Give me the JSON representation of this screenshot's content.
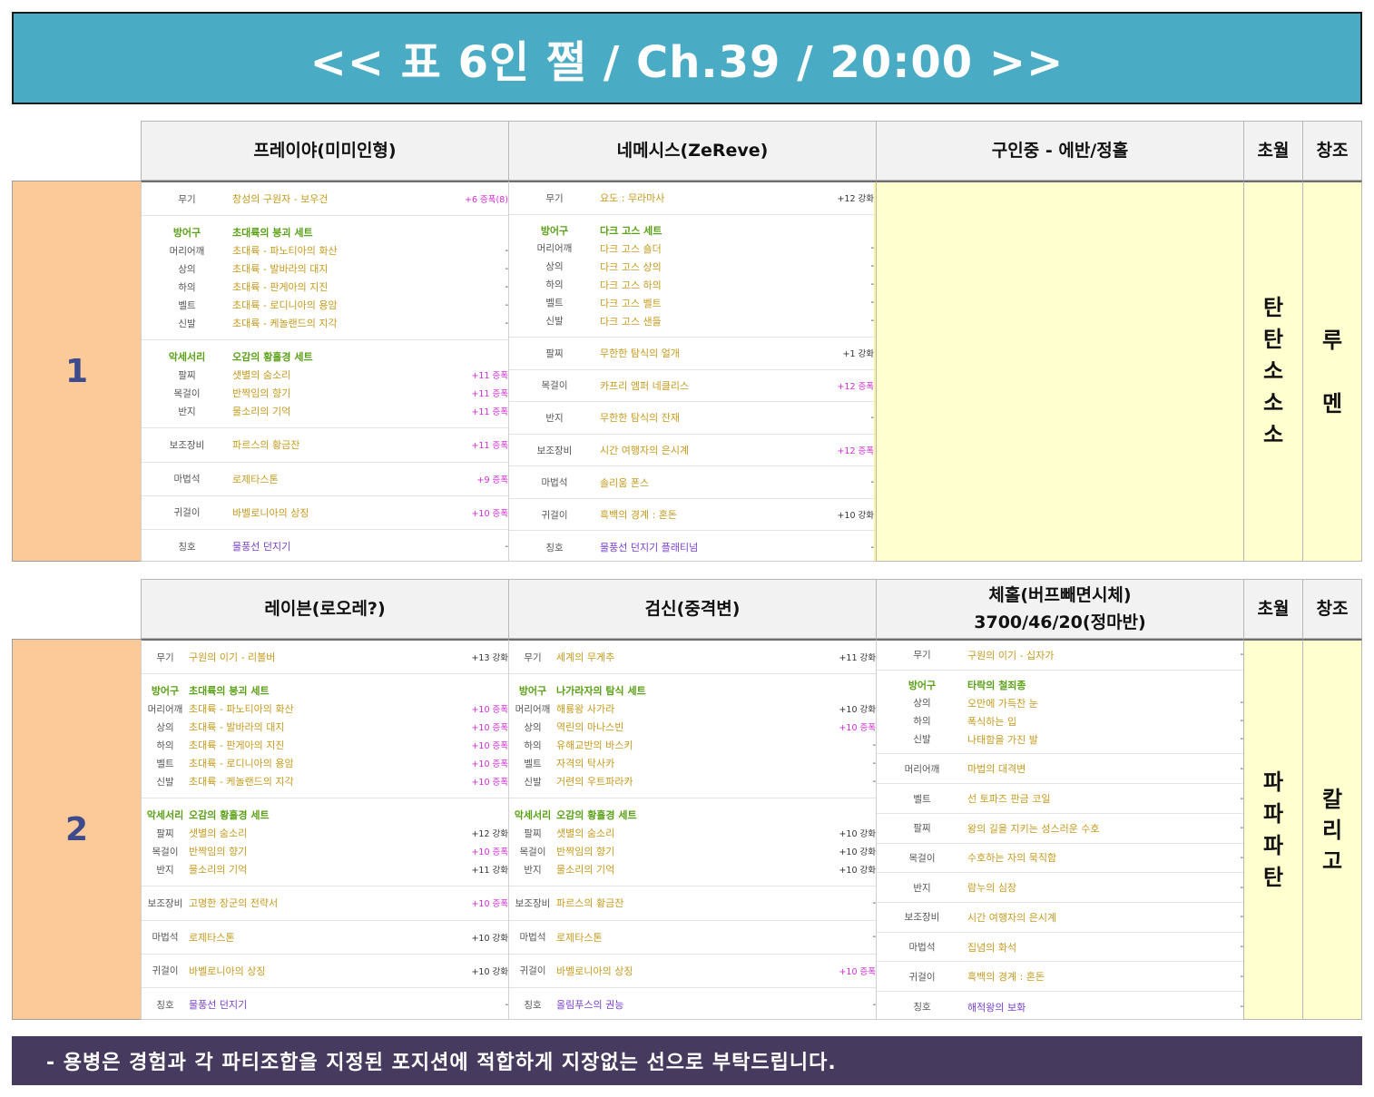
{
  "title": "<< 표 6인 쩔 / Ch.39 / 20:00 >>",
  "footer": "- 용병은 경험과 각 파티조합을 지정된 포지션에 적합하게 지장없는 선으로 부탁드립니다.",
  "parties": [
    {
      "number": "1",
      "col4": "초월",
      "col5": "창조",
      "col4_value": [
        "탄",
        "탄",
        "소",
        "소",
        "소"
      ],
      "col5_value": [
        "루",
        "멘"
      ],
      "members": [
        {
          "header": [
            "프레이야(미미인형)"
          ],
          "groups": [
            [
              {
                "label": "무기",
                "name": "창성의 구원자 - 보우건",
                "value": "+6 증폭(8)"
              }
            ],
            [
              {
                "label": "방어구",
                "name": "초대륙의 붕괴 세트",
                "value": ""
              },
              {
                "label": "머리어깨",
                "name": "초대륙 - 파노티아의 화산",
                "value": "-"
              },
              {
                "label": "상의",
                "name": "초대륙 - 발바라의 대지",
                "value": "-"
              },
              {
                "label": "하의",
                "name": "초대륙 - 판게아의 지진",
                "value": "-"
              },
              {
                "label": "벨트",
                "name": "초대륙 - 로디니아의 용암",
                "value": "-"
              },
              {
                "label": "신발",
                "name": "초대륙 - 케놀랜드의 지각",
                "value": "-"
              }
            ],
            [
              {
                "label": "악세서리",
                "name": "오감의 황홀경 세트",
                "value": ""
              },
              {
                "label": "팔찌",
                "name": "샛별의 숨소리",
                "value": "+11 증폭"
              },
              {
                "label": "목걸이",
                "name": "반짝임의 향기",
                "value": "+11 증폭"
              },
              {
                "label": "반지",
                "name": "물소리의 기억",
                "value": "+11 증폭"
              }
            ],
            [
              {
                "label": "보조장비",
                "name": "파르스의 황금잔",
                "value": "+11 증폭"
              }
            ],
            [
              {
                "label": "마법석",
                "name": "로제타스톤",
                "value": "+9 증폭"
              }
            ],
            [
              {
                "label": "귀걸이",
                "name": "바벨로니아의 상징",
                "value": "+10 증폭"
              }
            ],
            [
              {
                "label": "칭호",
                "name": "물풍선 던지기",
                "value": "-"
              }
            ]
          ]
        },
        {
          "header": [
            "네메시스(ZeReve)"
          ],
          "groups": [
            [
              {
                "label": "무기",
                "name": "요도 : 무라마사",
                "value": "+12 강화"
              }
            ],
            [
              {
                "label": "방어구",
                "name": "다크 고스 세트",
                "value": ""
              },
              {
                "label": "머리어깨",
                "name": "다크 고스 숄더",
                "value": "-"
              },
              {
                "label": "상의",
                "name": "다크 고스 상의",
                "value": "-"
              },
              {
                "label": "하의",
                "name": "다크 고스 하의",
                "value": "-"
              },
              {
                "label": "벨트",
                "name": "다크 고스 벨트",
                "value": "-"
              },
              {
                "label": "신발",
                "name": "다크 고스 샌들",
                "value": "-"
              }
            ],
            [
              {
                "label": "팔찌",
                "name": "무한한 탐식의 얼개",
                "value": "+1 강화"
              }
            ],
            [
              {
                "label": "목걸이",
                "name": "카프리 엠퍼 네클리스",
                "value": "+12 증폭"
              }
            ],
            [
              {
                "label": "반지",
                "name": "무한한 탐식의 잔재",
                "value": "-"
              }
            ],
            [
              {
                "label": "보조장비",
                "name": "시간 여행자의 은시계",
                "value": "+12 증폭"
              }
            ],
            [
              {
                "label": "마법석",
                "name": "솔리움 폰스",
                "value": "-"
              }
            ],
            [
              {
                "label": "귀걸이",
                "name": "흑백의 경계 : 혼돈",
                "value": "+10 강화"
              }
            ],
            [
              {
                "label": "칭호",
                "name": "물풍선 던지기 플래티넘",
                "value": "-"
              }
            ]
          ]
        },
        {
          "header": [
            "구인중 - 에반/정홀"
          ],
          "groups": []
        }
      ]
    },
    {
      "number": "2",
      "col4": "초월",
      "col5": "창조",
      "col4_value": [
        "파",
        "파",
        "파",
        "탄"
      ],
      "col5_value": [
        "칼",
        "리",
        "고"
      ],
      "members": [
        {
          "header": [
            "레이븐(로오레?)"
          ],
          "groups": [
            [
              {
                "label": "무기",
                "name": "구원의 이기 - 리볼버",
                "value": "+13 강화"
              }
            ],
            [
              {
                "label": "방어구",
                "name": "초대륙의 붕괴 세트",
                "value": ""
              },
              {
                "label": "머리어깨",
                "name": "초대륙 - 파노티아의 화산",
                "value": "+10 증폭"
              },
              {
                "label": "상의",
                "name": "초대륙 - 발바라의 대지",
                "value": "+10 증폭"
              },
              {
                "label": "하의",
                "name": "초대륙 - 판게아의 지진",
                "value": "+10 증폭"
              },
              {
                "label": "벨트",
                "name": "초대륙 - 로디니아의 용암",
                "value": "+10 증폭"
              },
              {
                "label": "신발",
                "name": "초대륙 - 케놀랜드의 지각",
                "value": "+10 증폭"
              }
            ],
            [
              {
                "label": "악세서리",
                "name": "오감의 황홀경 세트",
                "value": ""
              },
              {
                "label": "팔찌",
                "name": "샛별의 숨소리",
                "value": "+12 강화"
              },
              {
                "label": "목걸이",
                "name": "반짝임의 향기",
                "value": "+10 증폭"
              },
              {
                "label": "반지",
                "name": "물소리의 기억",
                "value": "+11 강화"
              }
            ],
            [
              {
                "label": "보조장비",
                "name": "고명한 장군의 전략서",
                "value": "+10 증폭"
              }
            ],
            [
              {
                "label": "마법석",
                "name": "로제타스톤",
                "value": "+10 강화"
              }
            ],
            [
              {
                "label": "귀걸이",
                "name": "바벨로니아의 상징",
                "value": "+10 강화"
              }
            ],
            [
              {
                "label": "칭호",
                "name": "물풍선 던지기",
                "value": "-"
              }
            ]
          ]
        },
        {
          "header": [
            "검신(중격변)"
          ],
          "groups": [
            [
              {
                "label": "무기",
                "name": "세계의 무게추",
                "value": "+11 강화"
              }
            ],
            [
              {
                "label": "방어구",
                "name": "나가라자의 탐식 세트",
                "value": ""
              },
              {
                "label": "머리어깨",
                "name": "해룡왕 사가라",
                "value": "+10 강화"
              },
              {
                "label": "상의",
                "name": "역린의 마나스빈",
                "value": "+10 증폭"
              },
              {
                "label": "하의",
                "name": "유해교반의 바스키",
                "value": "-"
              },
              {
                "label": "벨트",
                "name": "자격의 탁사카",
                "value": "-"
              },
              {
                "label": "신발",
                "name": "거련의 우트파라카",
                "value": "-"
              }
            ],
            [
              {
                "label": "악세서리",
                "name": "오감의 황홀경 세트",
                "value": ""
              },
              {
                "label": "팔찌",
                "name": "샛별의 숨소리",
                "value": "+10 강화"
              },
              {
                "label": "목걸이",
                "name": "반짝임의 향기",
                "value": "+10 강화"
              },
              {
                "label": "반지",
                "name": "물소리의 기억",
                "value": "+10 강화"
              }
            ],
            [
              {
                "label": "보조장비",
                "name": "파르스의 황금잔",
                "value": "-"
              }
            ],
            [
              {
                "label": "마법석",
                "name": "로제타스톤",
                "value": "-"
              }
            ],
            [
              {
                "label": "귀걸이",
                "name": "바벨로니아의 상징",
                "value": "+10 증폭"
              }
            ],
            [
              {
                "label": "칭호",
                "name": "올림푸스의 권능",
                "value": "-"
              }
            ]
          ]
        },
        {
          "header": [
            "체홀(버프빼면시체)",
            "3700/46/20(정마반)"
          ],
          "groups": [
            [
              {
                "label": "무기",
                "name": "구원의 이기 - 십자가",
                "value": "-"
              }
            ],
            [
              {
                "label": "방어구",
                "name": "타락의 철죄종",
                "value": ""
              },
              {
                "label": "상의",
                "name": "오만에 가득찬 눈",
                "value": "-"
              },
              {
                "label": "하의",
                "name": "폭식하는 입",
                "value": "-"
              },
              {
                "label": "신발",
                "name": "나태함을 가진 발",
                "value": "-"
              }
            ],
            [
              {
                "label": "머리어깨",
                "name": "마법의 대격변",
                "value": "-"
              }
            ],
            [
              {
                "label": "벨트",
                "name": "선 토파즈 판금 코일",
                "value": "-"
              }
            ],
            [
              {
                "label": "팔찌",
                "name": "왕의 길을 지키는 성스러운 수호",
                "value": "-"
              }
            ],
            [
              {
                "label": "목걸이",
                "name": "수호하는 자의 묵직함",
                "value": "-"
              }
            ],
            [
              {
                "label": "반지",
                "name": "람누의 심장",
                "value": "-"
              }
            ],
            [
              {
                "label": "보조장비",
                "name": "시간 여행자의 은시계",
                "value": "-"
              }
            ],
            [
              {
                "label": "마법석",
                "name": "집념의 화석",
                "value": "-"
              }
            ],
            [
              {
                "label": "귀걸이",
                "name": "흑백의 경계 : 혼돈",
                "value": "-"
              }
            ],
            [
              {
                "label": "칭호",
                "name": "해적왕의 보화",
                "value": "-"
              }
            ]
          ]
        }
      ]
    }
  ]
}
